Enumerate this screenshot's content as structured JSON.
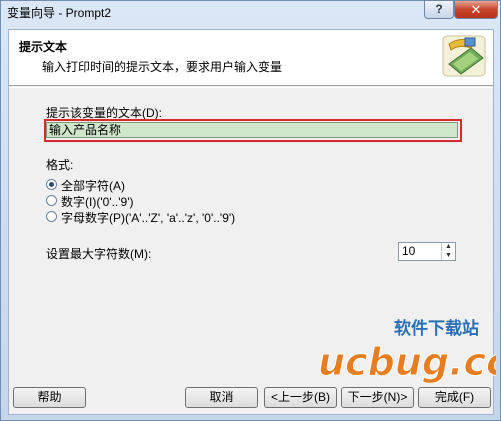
{
  "window": {
    "title": "变量向导 - Prompt2",
    "help_glyph": "?",
    "close_glyph": "✕"
  },
  "header": {
    "title": "提示文本",
    "description": "输入打印时间的提示文本，要求用户输入变量"
  },
  "prompt": {
    "label": "提示该变量的文本(D):",
    "value": "输入产品名称"
  },
  "format": {
    "label": "格式:",
    "options": [
      {
        "label": "全部字符(A)",
        "selected": true
      },
      {
        "label": "数字(I)('0'..'9')",
        "selected": false
      },
      {
        "label": "字母数字(P)('A'..'Z', 'a'..'z', '0'..'9')",
        "selected": false
      }
    ]
  },
  "max_chars": {
    "label": "设置最大字符数(M):",
    "value": "10"
  },
  "buttons": {
    "help": "帮助",
    "cancel": "取消",
    "back": "<上一步(B)",
    "next": "下一步(N)>",
    "finish": "完成(F)"
  },
  "watermark": {
    "text": "软件下载站",
    "logo": "ucbug.cc"
  }
}
